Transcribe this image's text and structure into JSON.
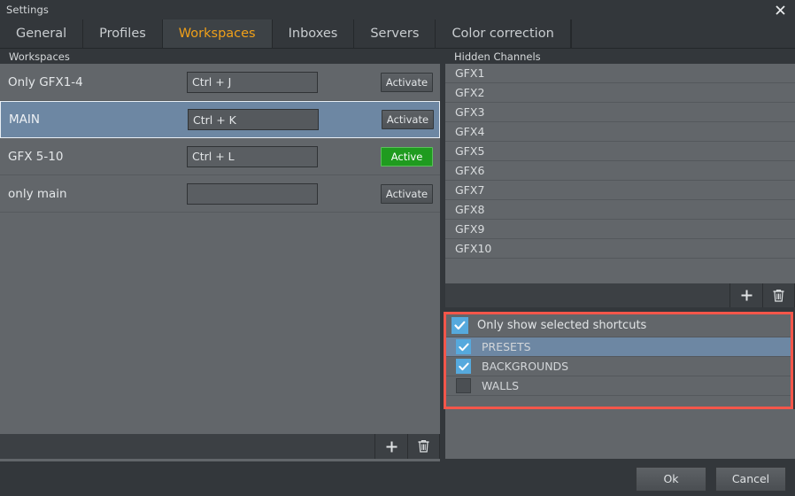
{
  "window": {
    "title": "Settings",
    "close_icon": "close-icon"
  },
  "tabs": [
    {
      "label": "General",
      "active": false
    },
    {
      "label": "Profiles",
      "active": false
    },
    {
      "label": "Workspaces",
      "active": true
    },
    {
      "label": "Inboxes",
      "active": false
    },
    {
      "label": "Servers",
      "active": false
    },
    {
      "label": "Color correction",
      "active": false
    }
  ],
  "colors": {
    "accent_tab": "#f0a019",
    "selection": "#6d87a3",
    "active_green": "#1f9b1f",
    "highlight_red": "#f4564a",
    "checkbox_blue": "#56a9dd",
    "panel_bg": "#62666a",
    "chrome_bg": "#33373b"
  },
  "workspaces_panel": {
    "header": "Workspaces",
    "rows": [
      {
        "name": "Only GFX1-4",
        "shortcut": "Ctrl + J",
        "button": "Activate",
        "active": false,
        "selected": false
      },
      {
        "name": "MAIN",
        "shortcut": "Ctrl + K",
        "button": "Activate",
        "active": false,
        "selected": true
      },
      {
        "name": "GFX 5-10",
        "shortcut": "Ctrl + L",
        "button": "Active",
        "active": true,
        "selected": false
      },
      {
        "name": "only main",
        "shortcut": "",
        "button": "Activate",
        "active": false,
        "selected": false
      }
    ],
    "toolbar": {
      "add_icon": "plus-icon",
      "delete_icon": "trash-icon"
    }
  },
  "hidden_channels_panel": {
    "header": "Hidden Channels",
    "items": [
      "GFX1",
      "GFX2",
      "GFX3",
      "GFX4",
      "GFX5",
      "GFX6",
      "GFX7",
      "GFX8",
      "GFX9",
      "GFX10"
    ],
    "toolbar": {
      "add_icon": "plus-icon",
      "delete_icon": "trash-icon"
    }
  },
  "shortcuts_panel": {
    "title": "Only show selected shortcuts",
    "title_checked": true,
    "items": [
      {
        "label": "PRESETS",
        "checked": true,
        "selected": true
      },
      {
        "label": "BACKGROUNDS",
        "checked": true,
        "selected": false
      },
      {
        "label": "WALLS",
        "checked": false,
        "selected": false
      }
    ]
  },
  "footer": {
    "ok_label": "Ok",
    "cancel_label": "Cancel"
  }
}
